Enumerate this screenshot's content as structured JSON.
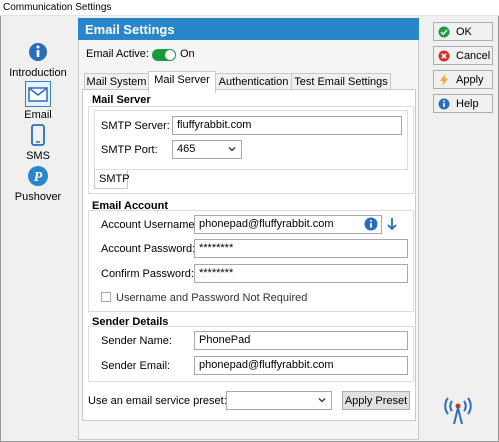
{
  "window": {
    "title": "Communication Settings"
  },
  "nav": {
    "items": [
      {
        "label": "Introduction",
        "icon": "info-icon"
      },
      {
        "label": "Email",
        "icon": "envelope-icon",
        "selected": true
      },
      {
        "label": "SMS",
        "icon": "phone-icon"
      },
      {
        "label": "Pushover",
        "icon": "pushover-icon"
      }
    ]
  },
  "panel": {
    "title": "Email Settings",
    "email_active_label": "Email Active:",
    "email_active_value": "On",
    "email_active": true
  },
  "tabs": [
    "Mail System",
    "Mail Server",
    "Authentication",
    "Test Email Settings"
  ],
  "selected_tab": "Mail Server",
  "mail_server": {
    "title": "Mail Server",
    "smtp_server_label": "SMTP Server:",
    "smtp_server_value": "fluffyrabbit.com",
    "smtp_port_label": "SMTP Port:",
    "smtp_port_value": "465",
    "subtab": "SMTP"
  },
  "email_account": {
    "title": "Email Account",
    "username_label": "Account Username:",
    "username_value": "phonepad@fluffyrabbit.com",
    "password_label": "Account Password:",
    "password_value": "********",
    "confirm_label": "Confirm Password:",
    "confirm_value": "********",
    "not_required_label": "Username and Password Not Required",
    "not_required_checked": false
  },
  "sender": {
    "title": "Sender Details",
    "name_label": "Sender Name:",
    "name_value": "PhonePad",
    "email_label": "Sender Email:",
    "email_value": "phonepad@fluffyrabbit.com"
  },
  "preset": {
    "label": "Use an email service preset:",
    "value": "",
    "apply_label": "Apply Preset"
  },
  "buttons": {
    "ok": "OK",
    "cancel": "Cancel",
    "apply": "Apply",
    "help": "Help"
  },
  "colors": {
    "accent": "#2a86cb",
    "toggle_on": "#1a9a3c",
    "info_blue": "#2a6ebb"
  }
}
